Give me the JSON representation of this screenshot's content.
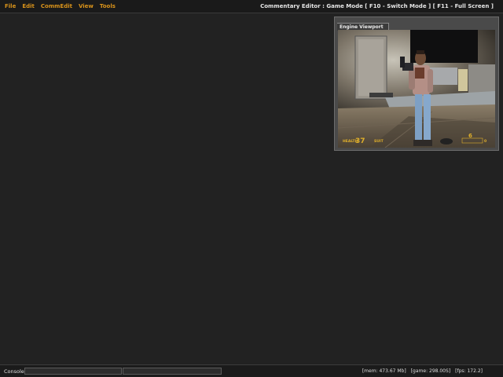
{
  "menubar": {
    "items": [
      "File",
      "Edit",
      "CommEdit",
      "View",
      "Tools"
    ],
    "title": "Commentary Editor : Game Mode [ F10 - Switch Mode ] [ F11 - Full Screen ]"
  },
  "viewport": {
    "tab_label": "Engine Viewport",
    "hud": {
      "health_label": "HEALTH",
      "health_value": "37",
      "suit_label": "SUIT",
      "ammo_value": "6",
      "ammo_reserve": "0"
    }
  },
  "statusbar": {
    "console_label": "Console",
    "console_value": "",
    "mem": "[mem: 473.67 Mb]",
    "game": "[game: 298.00S]",
    "fps": "[fps: 172.2]"
  },
  "colors": {
    "background": "#222222",
    "menu_accent": "#d9931a",
    "panel": "#4a4a4a",
    "hud": "#e0b02a"
  }
}
